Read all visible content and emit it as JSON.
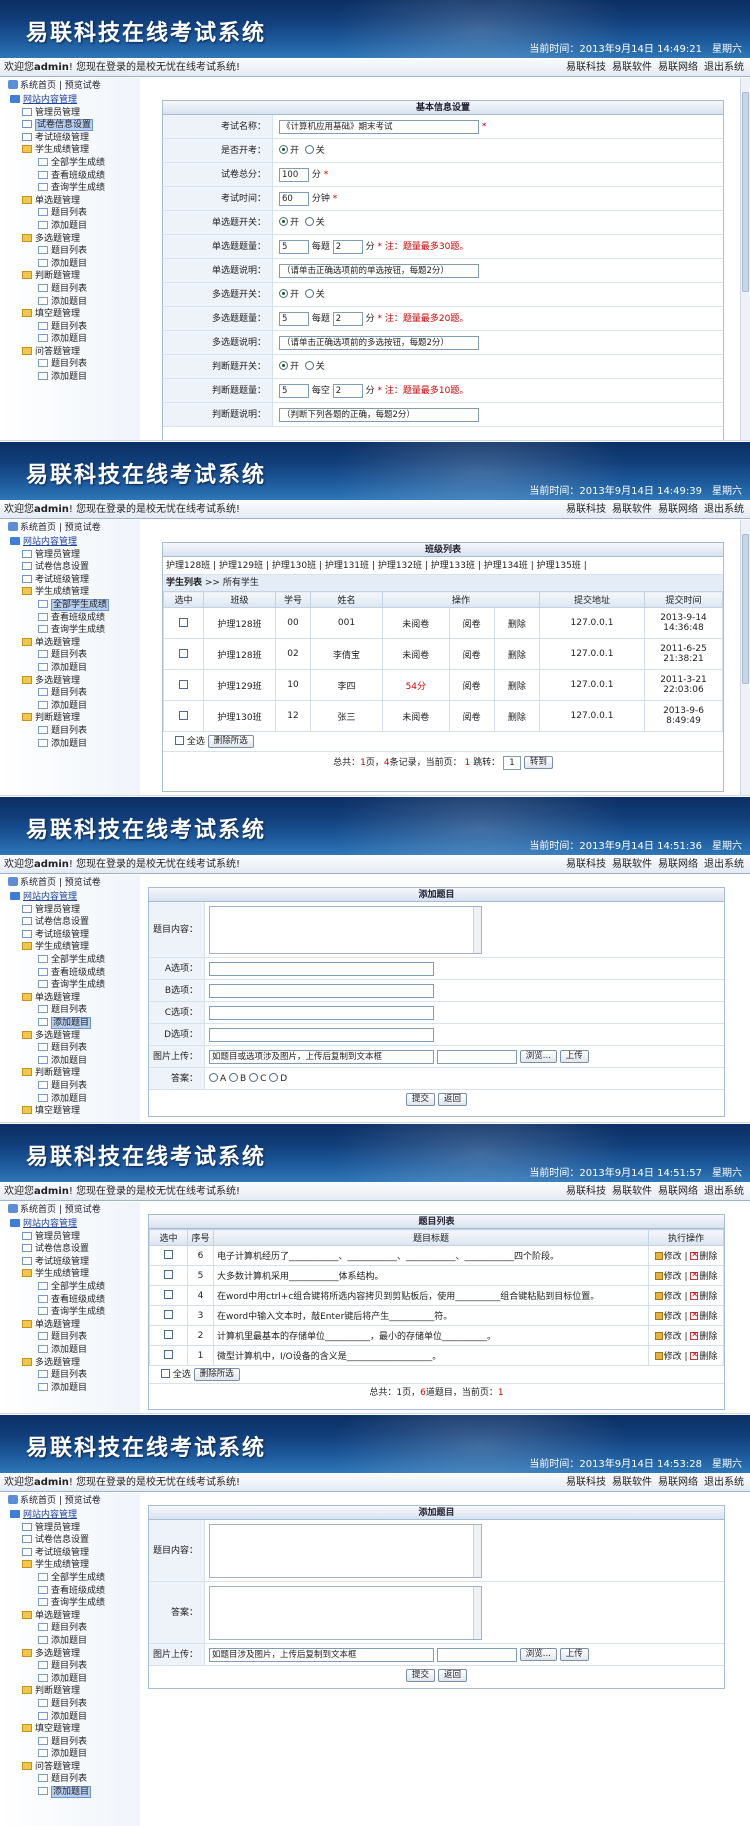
{
  "app_title": "易联科技在线考试系统",
  "time_label": "当前时间：",
  "welcome_prefix": "欢迎您",
  "welcome_user": "admin",
  "welcome_suffix": "! 您现在登录的是校无忧在线考试系统!",
  "top_links": [
    "易联科技",
    "易联软件",
    "易联网络",
    "退出系统"
  ],
  "sidebar_toolbar": {
    "home": "系统首页",
    "preview": "预览试卷"
  },
  "screens": [
    {
      "date": "2013年9月14日",
      "time": "14:49:21",
      "weekday": "星期六"
    },
    {
      "date": "2013年9月14日",
      "time": "14:49:39",
      "weekday": "星期六"
    },
    {
      "date": "2013年9月14日",
      "time": "14:51:36",
      "weekday": "星期六"
    },
    {
      "date": "2013年9月14日",
      "time": "14:51:57",
      "weekday": "星期六"
    },
    {
      "date": "2013年9月14日",
      "time": "14:53:28",
      "weekday": "星期六"
    }
  ],
  "tree": {
    "root": "网站内容管理",
    "admin": "管理员管理",
    "exam_info": "试卷信息设置",
    "class_mgmt": "考试班级管理",
    "score_mgmt": "学生成绩管理",
    "all_scores": "全部学生成绩",
    "class_scores": "查看班级成绩",
    "query_scores": "查询学生成绩",
    "single_mgmt": "单选题管理",
    "multi_mgmt": "多选题管理",
    "judge_mgmt": "判断题管理",
    "fill_mgmt": "填空题管理",
    "qa_mgmt": "问答题管理",
    "list": "题目列表",
    "add": "添加题目"
  },
  "basic": {
    "header": "基本信息设置",
    "rows": [
      {
        "label": "考试名称：",
        "value": "《计算机应用基础》期末考试",
        "note": "*"
      },
      {
        "label": "是否开考：",
        "on": "开",
        "off": "关"
      },
      {
        "label": "试卷总分：",
        "value": "100",
        "unit": "分",
        "note": "*"
      },
      {
        "label": "考试时间：",
        "value": "60",
        "unit": "分钟",
        "note": "*"
      },
      {
        "label": "单选题开关：",
        "on": "开",
        "off": "关"
      },
      {
        "label": "单选题题量：",
        "count": "5",
        "per": "每题",
        "score": "2",
        "unit": "分",
        "note": "* 注：题量最多30题。"
      },
      {
        "label": "单选题说明：",
        "value": "（请单击正确选项前的单选按钮，每题2分）"
      },
      {
        "label": "多选题开关：",
        "on": "开",
        "off": "关"
      },
      {
        "label": "多选题题量：",
        "count": "5",
        "per": "每题",
        "score": "2",
        "unit": "分",
        "note": "* 注：题量最多20题。"
      },
      {
        "label": "多选题说明：",
        "value": "（请单击正确选项前的多选按钮，每题2分）"
      },
      {
        "label": "判断题开关：",
        "on": "开",
        "off": "关"
      },
      {
        "label": "判断题题量：",
        "count": "5",
        "per": "每空",
        "score": "2",
        "unit": "分",
        "note": "* 注：题量最多10题。"
      },
      {
        "label": "判断题说明：",
        "value": "（判断下列各题的正确，每题2分）"
      }
    ]
  },
  "classlist": {
    "header": "班级列表",
    "classes": [
      "护理128班",
      "护理129班",
      "护理130班",
      "护理131班",
      "护理132班",
      "护理133班",
      "护理134班",
      "护理135班"
    ],
    "student_list": "学生列表",
    "breadcrumb": ">> 所有学生",
    "columns": [
      "选中",
      "班级",
      "学号",
      "姓名",
      "操作",
      "提交地址",
      "提交时间"
    ],
    "rows": [
      {
        "cls": "护理128班",
        "no": "00",
        "name": "001",
        "status": "未阅卷",
        "review": "阅卷",
        "del": "删除",
        "ip": "127.0.0.1",
        "date": "2013-9-14",
        "time": "14:36:48"
      },
      {
        "cls": "护理128班",
        "no": "02",
        "name": "李倩宝",
        "status": "未阅卷",
        "review": "阅卷",
        "del": "删除",
        "ip": "127.0.0.1",
        "date": "2011-6-25",
        "time": "21:38:21"
      },
      {
        "cls": "护理129班",
        "no": "10",
        "name": "李四",
        "status": "54分",
        "review": "阅卷",
        "del": "删除",
        "ip": "127.0.0.1",
        "date": "2011-3-21",
        "time": "22:03:06"
      },
      {
        "cls": "护理130班",
        "no": "12",
        "name": "张三",
        "status": "未阅卷",
        "review": "阅卷",
        "del": "删除",
        "ip": "127.0.0.1",
        "date": "2013-9-6",
        "time": "8:49:49"
      }
    ],
    "select_all": "全选",
    "delete_selected": "删除所选",
    "pager": {
      "a": "总共：",
      "pages": "1",
      "b": "页，",
      "records": "4",
      "c": "条记录，当前页：",
      "cur": "1",
      "d": "跳转：",
      "input": "1",
      "go": "转到"
    }
  },
  "addq": {
    "header": "添加题目",
    "content_label": "题目内容：",
    "options": [
      "A选项：",
      "B选项：",
      "C选项：",
      "D选项："
    ],
    "img_label": "图片上传：",
    "img_hint": "如题目或选项涉及图片，上传后复制到文本框",
    "browse": "浏览...",
    "upload": "上传",
    "answer_label": "答案：",
    "answers": [
      "A",
      "B",
      "C",
      "D"
    ],
    "submit": "提交",
    "back": "返回"
  },
  "qlist": {
    "header": "题目列表",
    "columns": [
      "选中",
      "序号",
      "题目标题",
      "执行操作"
    ],
    "rows": [
      {
        "no": "6",
        "title": "电子计算机经历了___________、___________、___________、___________四个阶段。"
      },
      {
        "no": "5",
        "title": "大多数计算机采用___________体系结构。"
      },
      {
        "no": "4",
        "title": "在word中用ctrl+c组合键将所选内容拷贝到剪贴板后，使用__________组合键粘贴到目标位置。"
      },
      {
        "no": "3",
        "title": "在word中输入文本时，敲Enter键后将产生__________符。"
      },
      {
        "no": "2",
        "title": "计算机里最基本的存储单位__________，最小的存储单位__________。"
      },
      {
        "no": "1",
        "title": "微型计算机中，I/O设备的含义是___________________。"
      }
    ],
    "edit": "修改",
    "del": "删除",
    "select_all": "全选",
    "delete_selected": "删除所选",
    "pager": {
      "a": "总共：",
      "pages": "1",
      "b": "页，",
      "count": "6",
      "c": "道题目，当前页：",
      "cur": "1"
    }
  },
  "addqa": {
    "header": "添加题目",
    "content_label": "题目内容：",
    "answer_label": "答案：",
    "img_label": "图片上传：",
    "img_hint": "如题目涉及图片，上传后复制到文本框",
    "browse": "浏览...",
    "upload": "上传",
    "submit": "提交",
    "back": "返回"
  }
}
